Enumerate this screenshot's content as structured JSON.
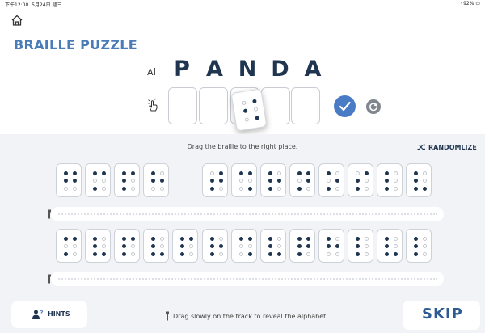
{
  "status_bar": {
    "time": "下午12:00",
    "date": "5月24日 週三",
    "battery": "92%"
  },
  "icons": {
    "home": "home-icon",
    "text": "text-size-icon",
    "touch": "touch-icon",
    "check": "check-icon",
    "reset": "reset-icon",
    "shuffle": "shuffle-icon",
    "torch": "flashlight-icon",
    "hints": "person-question-icon"
  },
  "colors": {
    "accent": "#4a7cc6",
    "title": "#4a7cb8",
    "dark": "#1f3550",
    "workspace": "#f1f3f6"
  },
  "title": "BRAILLE PUZZLE",
  "word": {
    "icon_text": "A",
    "letters": [
      "P",
      "A",
      "N",
      "D",
      "A"
    ]
  },
  "answer_slots": {
    "count": 5,
    "dragged_tile": [
      0,
      1,
      1,
      0,
      0,
      1
    ]
  },
  "instruction": "Drag the braille to the right place.",
  "randomize_label": "RANDOMLIZE",
  "tiles_row1": [
    [
      1,
      1,
      1,
      1,
      0,
      0
    ],
    [
      1,
      1,
      0,
      0,
      1,
      0
    ],
    [
      1,
      1,
      1,
      0,
      1,
      0
    ],
    [
      1,
      0,
      1,
      1,
      0,
      0
    ],
    [
      0,
      1,
      1,
      1,
      1,
      0
    ],
    [
      1,
      1,
      0,
      0,
      0,
      1
    ],
    [
      1,
      0,
      1,
      1,
      1,
      0
    ],
    [
      1,
      1,
      0,
      1,
      1,
      0
    ],
    [
      1,
      0,
      0,
      1,
      1,
      0
    ],
    [
      0,
      1,
      1,
      0,
      1,
      0
    ],
    [
      1,
      0,
      1,
      0,
      1,
      0
    ],
    [
      1,
      0,
      1,
      0,
      1,
      1
    ]
  ],
  "tiles_row2": [
    [
      1,
      1,
      0,
      0,
      1,
      0
    ],
    [
      1,
      0,
      1,
      0,
      1,
      1
    ],
    [
      1,
      1,
      1,
      0,
      1,
      0
    ],
    [
      1,
      0,
      1,
      0,
      1,
      1
    ],
    [
      1,
      1,
      1,
      0,
      1,
      0
    ],
    [
      1,
      0,
      1,
      1,
      1,
      0
    ],
    [
      1,
      1,
      0,
      0,
      0,
      1
    ],
    [
      1,
      0,
      1,
      0,
      1,
      1
    ],
    [
      1,
      1,
      1,
      1,
      1,
      0
    ],
    [
      1,
      0,
      1,
      1,
      0,
      0
    ],
    [
      1,
      0,
      1,
      0,
      1,
      0
    ],
    [
      1,
      0,
      1,
      0,
      1,
      1
    ],
    [
      1,
      0,
      1,
      0,
      1,
      0
    ]
  ],
  "hints_label": "HINTS",
  "footer_note": "Drag slowly on the track to reveal the alphabet.",
  "skip_label": "SKIP"
}
